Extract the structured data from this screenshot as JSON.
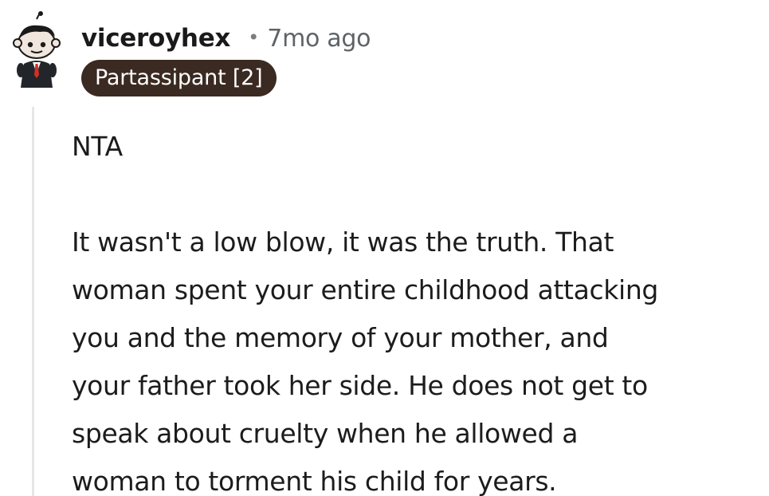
{
  "comment": {
    "username": "viceroyhex",
    "separator": "•",
    "timestamp": "7mo ago",
    "flair": "Partassipant [2]",
    "body": {
      "verdict": "NTA",
      "lines": [
        "It wasn't a low blow, it was the truth. That",
        "woman spent your entire childhood attacking",
        "you and the memory of your mother, and",
        "your father took her side. He does not get to",
        "speak about cruelty when he allowed a",
        "woman to torment his child for years."
      ]
    },
    "avatar_icon": "snoo-avatar-icon",
    "colors": {
      "flair_background": "#3b2a22",
      "flair_text": "#ffffff",
      "timestamp": "#5f6368",
      "thread_line": "#e6e6e6"
    }
  }
}
